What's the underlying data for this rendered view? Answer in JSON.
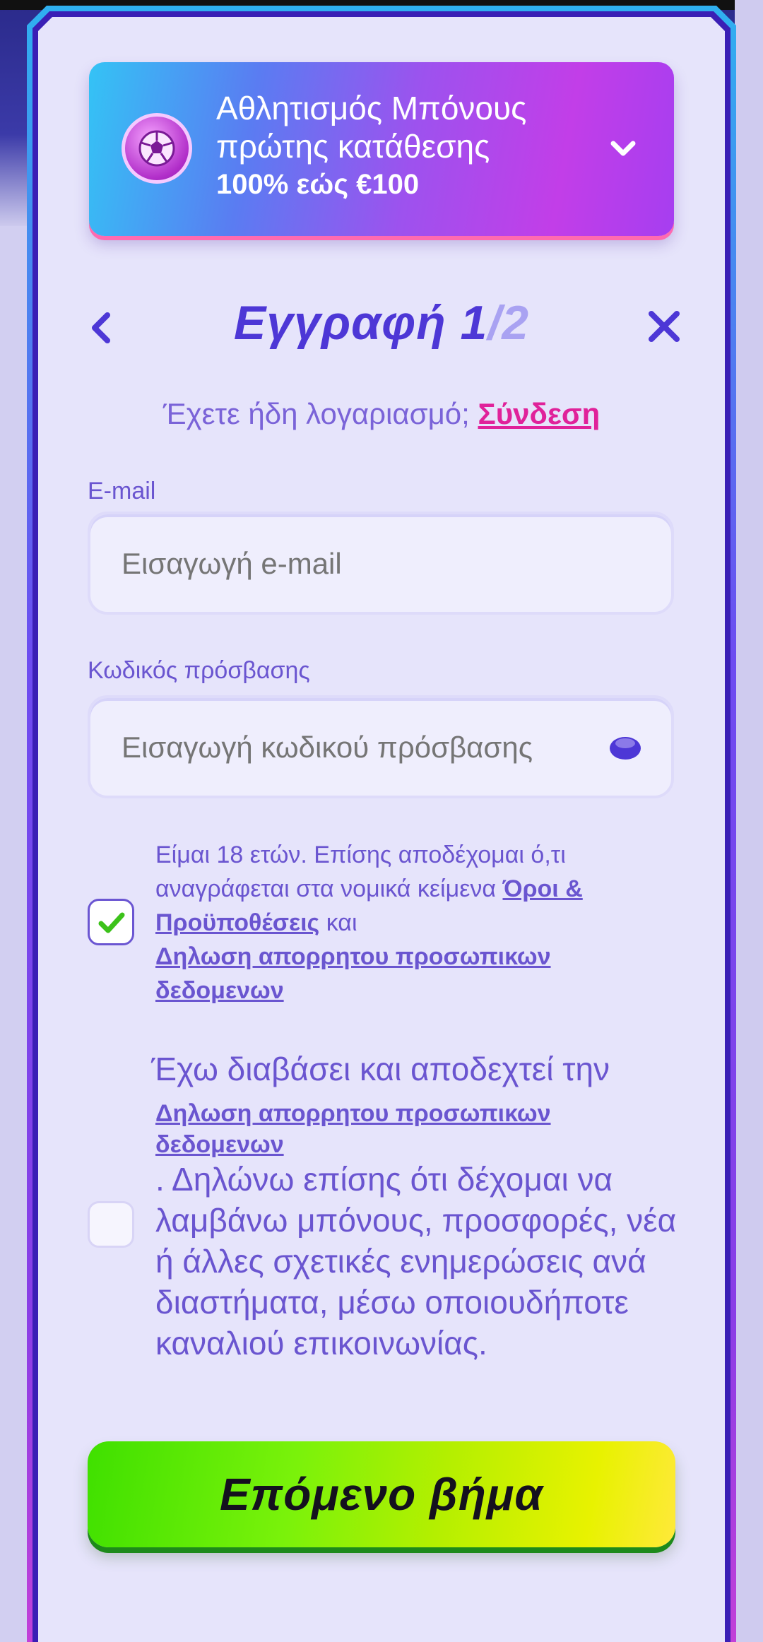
{
  "bonus": {
    "line1": "Αθλητισμός Μπόνους",
    "line2": "πρώτης κατάθεσης",
    "line3": "100% εώς €100",
    "icon": "soccer-ball-icon"
  },
  "header": {
    "title": "Εγγραφή 1",
    "step_total": "/2"
  },
  "login": {
    "prompt": "Έχετε ήδη λογαριασμό; ",
    "link": "Σύνδεση"
  },
  "email": {
    "label": "E-mail",
    "placeholder": "Εισαγωγή e-mail",
    "value": ""
  },
  "password": {
    "label": "Κωδικός πρόσβασης",
    "placeholder": "Εισαγωγή κωδικού πρόσβασης",
    "value": ""
  },
  "terms1": {
    "checked": true,
    "text": "Είμαι 18 ετών. Επίσης αποδέχομαι ό,τι αναγράφεται στα νομικά κείμενα ",
    "link1": "Όροι & Προϋποθέσεις",
    "and": " και ",
    "link2": "Δηλωση απορρητου προσωπικων δεδομενων"
  },
  "terms2": {
    "checked": false,
    "head": "Έχω διαβάσει και αποδεχτεί την",
    "link": "Δηλωση απορρητου προσωπικων δεδομενων",
    "body": ". Δηλώνω επίσης ότι δέχομαι να λαμβάνω μπόνους, προσφορές, νέα ή άλλες σχετικές ενημερώσεις ανά διαστήματα, μέσω οποιουδήποτε καναλιού επικοινωνίας."
  },
  "next_button": {
    "label": "Επόμενο βήμα"
  },
  "colors": {
    "accent": "#4d37d6",
    "link": "#e0229a",
    "text": "#6a55d0",
    "button": "#7af20a"
  }
}
